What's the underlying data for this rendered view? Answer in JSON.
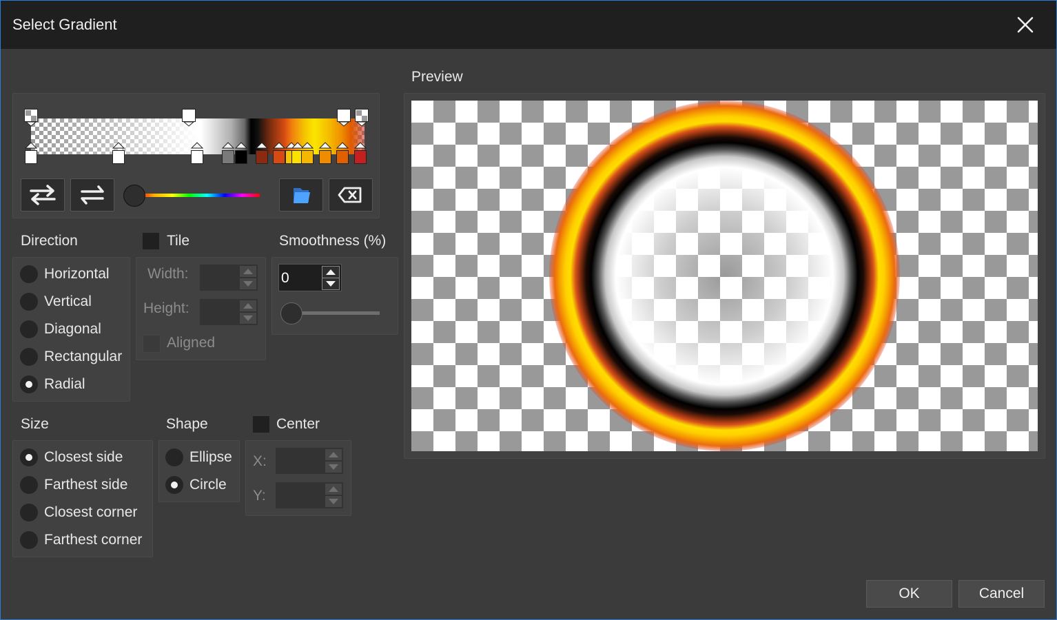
{
  "window": {
    "title": "Select Gradient"
  },
  "preview": {
    "label": "Preview"
  },
  "gradient_editor": {
    "colors": {
      "top_stops": [
        "transparent",
        "#ffffff",
        "#ffffff",
        "transparent"
      ],
      "bottom_stops": [
        "#ffffff",
        "#ffffff",
        "#ffffff",
        "#7a7a7a",
        "#000000",
        "#8a2a10",
        "#d74b12",
        "#f5c400",
        "#fbe200",
        "#f5b700",
        "#f08c00",
        "#e06000",
        "#c42020"
      ]
    }
  },
  "toolbar": {
    "reverse_icon": "reverse-arrows-icon",
    "mirror_icon": "mirror-arrows-icon",
    "load_icon": "folder-icon",
    "delete_icon": "backspace-icon"
  },
  "direction": {
    "label": "Direction",
    "options": [
      "Horizontal",
      "Vertical",
      "Diagonal",
      "Rectangular",
      "Radial"
    ],
    "selected": "Radial"
  },
  "tile": {
    "label": "Tile",
    "checked": false,
    "width_label": "Width:",
    "height_label": "Height:",
    "aligned_label": "Aligned"
  },
  "smoothness": {
    "label": "Smoothness (%)",
    "value": "0",
    "slider_percent": 0
  },
  "size": {
    "label": "Size",
    "options": [
      "Closest side",
      "Farthest side",
      "Closest corner",
      "Farthest corner"
    ],
    "selected": "Closest side"
  },
  "shape": {
    "label": "Shape",
    "options": [
      "Ellipse",
      "Circle"
    ],
    "selected": "Circle"
  },
  "center": {
    "label": "Center",
    "checked": false,
    "x_label": "X:",
    "y_label": "Y:"
  },
  "buttons": {
    "ok": "OK",
    "cancel": "Cancel"
  }
}
